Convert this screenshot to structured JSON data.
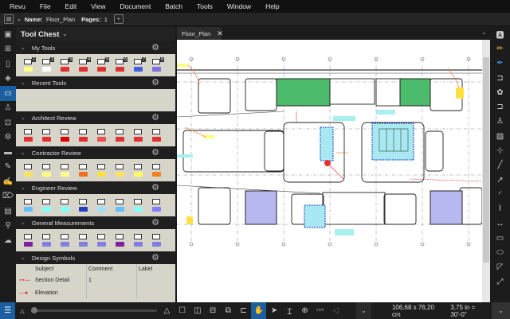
{
  "menu": [
    "Revu",
    "File",
    "Edit",
    "View",
    "Document",
    "Batch",
    "Tools",
    "Window",
    "Help"
  ],
  "toolbar": {
    "name_label": "Name:",
    "name_value": "Floor_Plan",
    "pages_label": "Pages:",
    "pages_value": "1"
  },
  "left_strip": [
    "thumbnails-icon",
    "grid-icon",
    "bookmarks-icon",
    "layers-icon",
    "toolchest-icon",
    "user-stamp-icon",
    "spaces-icon",
    "gear-icon",
    "measure-icon",
    "markups-list-icon",
    "signature-icon",
    "tags-icon",
    "forms-icon",
    "search-icon",
    "studio-icon"
  ],
  "panel": {
    "title": "Tool Chest",
    "sections": [
      {
        "label": "My Tools",
        "tools": [
          [
            "#ffff80",
            "1"
          ],
          [
            "#ffffff",
            "2"
          ],
          [
            "#e03030",
            "3"
          ],
          [
            "#e03030",
            "4"
          ],
          [
            "#e03030",
            "5"
          ],
          [
            "#e03030",
            "6"
          ],
          [
            "#4060e0",
            "7"
          ],
          [
            "#8070e0",
            "8"
          ]
        ]
      },
      {
        "label": "Recent Tools",
        "tools": []
      },
      {
        "label": "Architect Review",
        "tools": [
          [
            "#e03030",
            ""
          ],
          [
            "#e03030",
            ""
          ],
          [
            "#e00000",
            ""
          ],
          [
            "#e03030",
            ""
          ],
          [
            "#f05050",
            ""
          ],
          [
            "#e03030",
            ""
          ],
          [
            "#e03030",
            ""
          ],
          [
            "#e03030",
            ""
          ]
        ]
      },
      {
        "label": "Contractor Review",
        "tools": [
          [
            "#ffe060",
            ""
          ],
          [
            "#ffff80",
            ""
          ],
          [
            "#ffff90",
            ""
          ],
          [
            "#f07020",
            ""
          ],
          [
            "#ffe040",
            ""
          ],
          [
            "#ffe060",
            ""
          ],
          [
            "#ffff60",
            ""
          ],
          [
            "#f08020",
            ""
          ]
        ]
      },
      {
        "label": "Engineer Review",
        "tools": [
          [
            "#60c0ff",
            ""
          ],
          [
            "#80ffff",
            ""
          ],
          [
            "#80ffff",
            ""
          ],
          [
            "#2040c0",
            ""
          ],
          [
            "#a0e0ff",
            ""
          ],
          [
            "#60c0ff",
            ""
          ],
          [
            "#80ffff",
            ""
          ],
          [
            "#8080ff",
            ""
          ]
        ]
      },
      {
        "label": "General Measurements",
        "tools": [
          [
            "#8020a0",
            ""
          ],
          [
            "#8080e0",
            ""
          ],
          [
            "#8080e0",
            ""
          ],
          [
            "#8080e0",
            ""
          ],
          [
            "#8080e0",
            ""
          ],
          [
            "#8020a0",
            ""
          ],
          [
            "#8080e0",
            ""
          ],
          [
            "#8080e0",
            ""
          ]
        ]
      },
      {
        "label": "Design Symbols",
        "tools": []
      }
    ],
    "table": {
      "headers": [
        "Subject",
        "Comment",
        "Label"
      ],
      "rows": [
        [
          "Section Detail",
          "1",
          ""
        ],
        [
          "Elevation",
          "",
          ""
        ]
      ]
    }
  },
  "tab": {
    "label": "Floor_Plan"
  },
  "right_tools": [
    "text-box-icon",
    "highlighter-icon",
    "pen-icon",
    "callout-icon",
    "cloud-icon",
    "callout-arrow-icon",
    "stamp-icon",
    "image-icon",
    "crop-icon",
    "line-icon",
    "arrow-icon",
    "arc-icon",
    "polyline-icon",
    "dimension-icon",
    "rectangle-icon",
    "ellipse-icon",
    "polygon-icon",
    "expand-icon"
  ],
  "status": {
    "dimensions": "106,68 x 76,20 cm",
    "scale": "3,75 in = 30'-0\""
  },
  "colors": {
    "accent": "#1c5fa0",
    "tool_bg": "#d7d4ca",
    "green_room": "#4cbb6c",
    "blue_room": "#b8b8f0",
    "cyan_room": "#a8e8f0"
  }
}
